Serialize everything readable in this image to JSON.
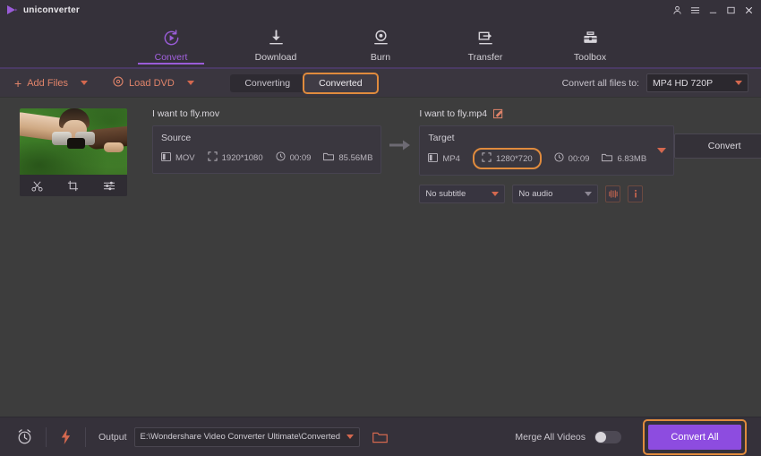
{
  "titlebar": {
    "app_name": "uniconverter",
    "icons": {
      "logo": "play-logo-icon",
      "account": "account-icon",
      "menu": "hamburger-menu-icon",
      "minimize": "minimize-icon",
      "maximize": "maximize-icon",
      "close": "close-icon"
    }
  },
  "header": {
    "nav": [
      {
        "label": "Convert",
        "icon": "convert-icon",
        "active": true
      },
      {
        "label": "Download",
        "icon": "download-icon",
        "active": false
      },
      {
        "label": "Burn",
        "icon": "burn-icon",
        "active": false
      },
      {
        "label": "Transfer",
        "icon": "transfer-icon",
        "active": false
      },
      {
        "label": "Toolbox",
        "icon": "toolbox-icon",
        "active": false
      }
    ]
  },
  "toolbar": {
    "add_files_label": "Add Files",
    "load_dvd_label": "Load DVD",
    "tabs": [
      {
        "label": "Converting",
        "selected": false
      },
      {
        "label": "Converted",
        "selected": true
      }
    ],
    "convert_all_to_label": "Convert all files to:",
    "convert_all_to_value": "MP4 HD 720P"
  },
  "file": {
    "thumbnail_tools": [
      "trim-icon",
      "crop-icon",
      "effects-icon"
    ],
    "source": {
      "title": "I want to fly.mov",
      "card_label": "Source",
      "format": "MOV",
      "resolution": "1920*1080",
      "duration": "00:09",
      "size": "85.56MB"
    },
    "target": {
      "title": "I want to fly.mp4",
      "card_label": "Target",
      "format": "MP4",
      "resolution": "1280*720",
      "duration": "00:09",
      "size": "6.83MB",
      "subtitle_value": "No subtitle",
      "audio_value": "No audio"
    },
    "convert_button_label": "Convert"
  },
  "footer": {
    "output_label": "Output",
    "output_path": "E:\\Wondershare Video Converter Ultimate\\Converted",
    "merge_label": "Merge All Videos",
    "merge_enabled": "off",
    "convert_all_label": "Convert All",
    "icons": {
      "timer": "alarm-clock-icon",
      "speed": "lightning-bolt-icon",
      "folder": "open-folder-icon"
    }
  },
  "colors": {
    "accent_purple": "#8d4ce0",
    "highlight_orange": "#e08b3d",
    "action_salmon": "#e0846a",
    "app_background": "#3d3d3d",
    "chrome_background": "#35313a"
  }
}
